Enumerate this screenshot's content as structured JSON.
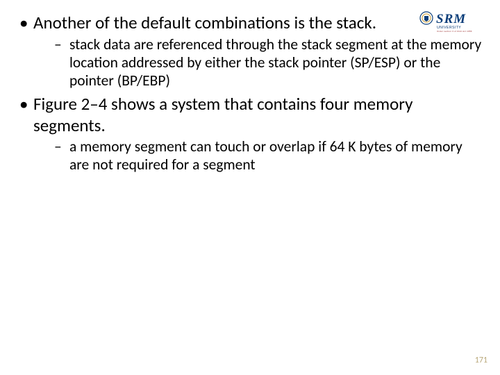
{
  "logo": {
    "name": "SRM",
    "subtitle": "UNIVERSITY",
    "tagline": "Under section 3 of UGC Act 1956"
  },
  "bullets": [
    {
      "text": "Another of the default combinations is the stack.",
      "sub": [
        "stack data are referenced through the stack segment at the memory location addressed by either the stack pointer (SP/ESP) or the pointer (BP/EBP)"
      ]
    },
    {
      "text": "Figure 2–4 shows a system that contains four memory segments.",
      "sub": [
        "a memory segment can touch or overlap if 64 K bytes of memory are not required for a segment"
      ]
    }
  ],
  "page_number": "171"
}
